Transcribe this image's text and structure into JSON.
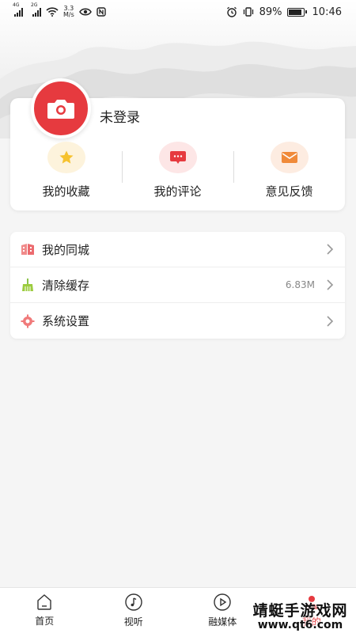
{
  "status_bar": {
    "sim1": "4G",
    "sim2": "2G",
    "speed_value": "3.3",
    "speed_unit": "M/s",
    "battery": "89%",
    "time": "10:46"
  },
  "profile": {
    "login_status": "未登录"
  },
  "quick_actions": [
    {
      "label": "我的收藏",
      "icon": "star-icon",
      "bg": "#fdf3dc",
      "color": "#f6c22e"
    },
    {
      "label": "我的评论",
      "icon": "comment-icon",
      "bg": "#fde6e6",
      "color": "#e63a3f"
    },
    {
      "label": "意见反馈",
      "icon": "mail-icon",
      "bg": "#fdece1",
      "color": "#f08a3a"
    }
  ],
  "menu": [
    {
      "label": "我的同城",
      "icon": "building-icon",
      "value": ""
    },
    {
      "label": "清除缓存",
      "icon": "broom-icon",
      "value": "6.83M"
    },
    {
      "label": "系统设置",
      "icon": "gear-icon",
      "value": ""
    }
  ],
  "bottom_nav": [
    {
      "label": "首页",
      "icon": "home-icon",
      "active": false
    },
    {
      "label": "视听",
      "icon": "music-icon",
      "active": false
    },
    {
      "label": "融媒体",
      "icon": "play-icon",
      "active": false
    },
    {
      "label": "我的",
      "icon": "user-icon",
      "active": true
    }
  ],
  "watermark": {
    "line1": "靖蜓手游戏网",
    "line2": "www.qt6.com"
  },
  "colors": {
    "accent": "#e63a3f",
    "background": "#f5f5f5"
  }
}
